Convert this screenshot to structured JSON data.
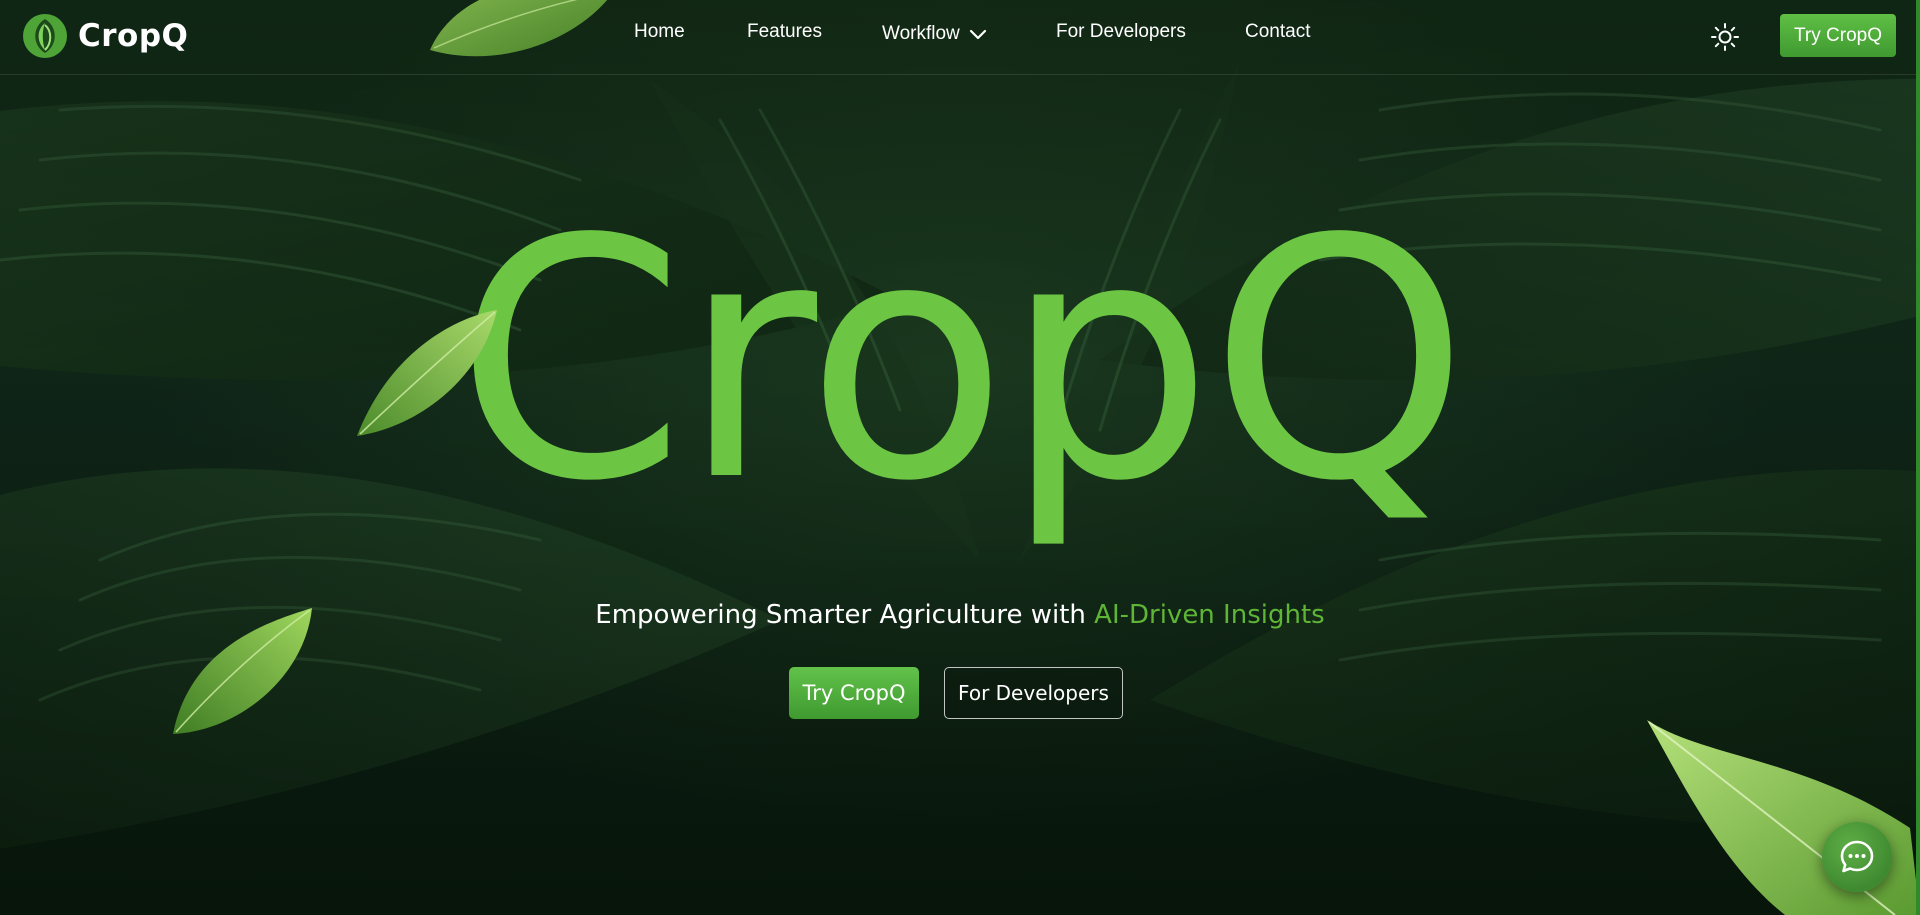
{
  "header": {
    "brand_name": "CropQ",
    "nav": {
      "home": "Home",
      "features": "Features",
      "workflow": "Workflow",
      "for_developers": "For Developers",
      "contact": "Contact"
    },
    "theme_toggle_icon": "sun-icon",
    "cta_label": "Try CropQ"
  },
  "hero": {
    "title": "CropQ",
    "tagline_prefix": "Empowering Smarter Agriculture with ",
    "tagline_accent": "AI-Driven Insights",
    "primary_cta": "Try CropQ",
    "secondary_cta": "For Developers"
  },
  "chat": {
    "icon": "chat-bubble-icon"
  },
  "colors": {
    "brand_green": "#6cc644",
    "accent_text": "#5fb536",
    "button_green": "#4faa38",
    "background": "#10281a"
  }
}
